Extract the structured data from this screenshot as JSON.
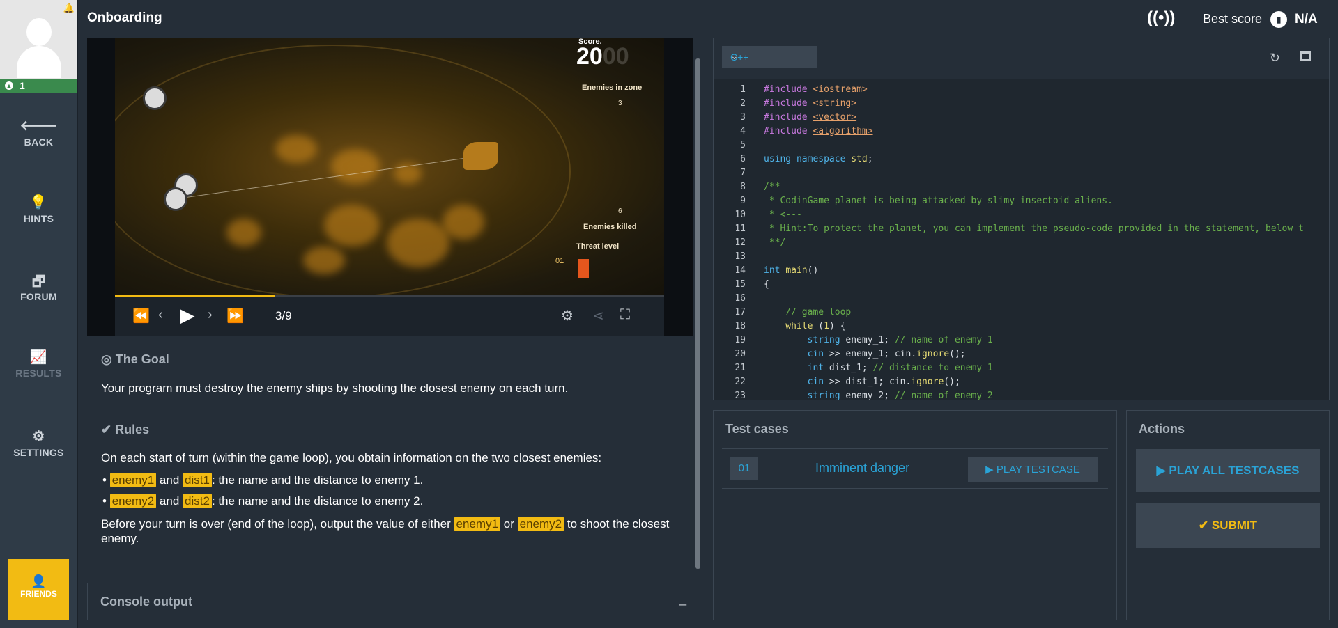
{
  "header": {
    "title": "Onboarding",
    "best_score_label": "Best score",
    "best_score_value": "N/A"
  },
  "sidebar": {
    "level": "1",
    "items": [
      {
        "label": "BACK"
      },
      {
        "label": "HINTS"
      },
      {
        "label": "FORUM"
      },
      {
        "label": "RESULTS"
      },
      {
        "label": "SETTINGS"
      }
    ],
    "friends": "FRIENDS"
  },
  "viewer": {
    "score_label": "Score.",
    "score_value": "20",
    "score_ghost": "00",
    "enemies_in_zone_label": "Enemies in zone",
    "enemies_in_zone_value": "3",
    "enemies_killed_label": "Enemies killed",
    "enemies_killed_value": "6",
    "threat_level_label": "Threat level",
    "threat_level_value": "01",
    "frame": "3/9",
    "progress": 0.29
  },
  "statement": {
    "goal_title": "The Goal",
    "goal_text": "Your program must destroy the enemy ships by shooting the closest enemy on each turn.",
    "rules_title": "Rules",
    "rules_intro": "On each start of turn (within the game loop), you obtain information on the two closest enemies:",
    "rule1": {
      "k1": "enemy1",
      "and": "and",
      "k2": "dist1",
      "text": ": the name and the distance to enemy 1."
    },
    "rule2": {
      "k1": "enemy2",
      "and": "and",
      "k2": "dist2",
      "text": ": the name and the distance to enemy 2."
    },
    "output_pre": "Before your turn is over (end of the loop), output the value of either",
    "output_k1": "enemy1",
    "output_or": "or",
    "output_k2": "enemy2",
    "output_post": "to shoot the closest enemy."
  },
  "console": {
    "title": "Console output",
    "min": "_"
  },
  "editor": {
    "language": "C++",
    "lines": [
      {
        "n": "1"
      },
      {
        "n": "2"
      },
      {
        "n": "3"
      },
      {
        "n": "4"
      },
      {
        "n": "5"
      },
      {
        "n": "6"
      },
      {
        "n": "7"
      },
      {
        "n": "8"
      },
      {
        "n": "9"
      },
      {
        "n": "10"
      },
      {
        "n": "11"
      },
      {
        "n": "12"
      },
      {
        "n": "13"
      },
      {
        "n": "14"
      },
      {
        "n": "15"
      },
      {
        "n": "16"
      },
      {
        "n": "17"
      },
      {
        "n": "18"
      },
      {
        "n": "19"
      },
      {
        "n": "20"
      },
      {
        "n": "21"
      },
      {
        "n": "22"
      },
      {
        "n": "23"
      }
    ],
    "code": {
      "l1a": "#include ",
      "l1b": "<iostream>",
      "l2a": "#include ",
      "l2b": "<string>",
      "l3a": "#include ",
      "l3b": "<vector>",
      "l4a": "#include ",
      "l4b": "<algorithm>",
      "l6a": "using ",
      "l6b": "namespace ",
      "l6c": "std",
      "l6d": ";",
      "l8": "/**",
      "l9": " * CodinGame planet is being attacked by slimy insectoid aliens.",
      "l10": " * <---",
      "l11": " * Hint:To protect the planet, you can implement the pseudo-code provided in the statement, below t",
      "l12": " **/",
      "l14a": "int ",
      "l14b": "main",
      "l14c": "()",
      "l15": "{",
      "l17": "    // game loop",
      "l18a": "    while ",
      "l18b": "(",
      "l18c": "1",
      "l18d": ") {",
      "l19a": "        string ",
      "l19b": "enemy_1; ",
      "l19c": "// name of enemy 1",
      "l20a": "        cin ",
      "l20b": ">> enemy_1; cin.",
      "l20c": "ignore",
      "l20d": "();",
      "l21a": "        int ",
      "l21b": "dist_1; ",
      "l21c": "// distance to enemy 1",
      "l22a": "        cin ",
      "l22b": ">> dist_1; cin.",
      "l22c": "ignore",
      "l22d": "();",
      "l23a": "        string ",
      "l23b": "enemy_2; ",
      "l23c": "// name of enemy 2"
    }
  },
  "tests": {
    "title": "Test cases",
    "case_num": "01",
    "case_name": "Imminent danger",
    "play_label": "PLAY TESTCASE"
  },
  "actions": {
    "title": "Actions",
    "play_all": "PLAY ALL TESTCASES",
    "submit": "SUBMIT"
  },
  "colors": {
    "accent": "#f2bb13",
    "link": "#2aa3d6",
    "panel": "#252e38",
    "success": "#3a8a4d"
  }
}
